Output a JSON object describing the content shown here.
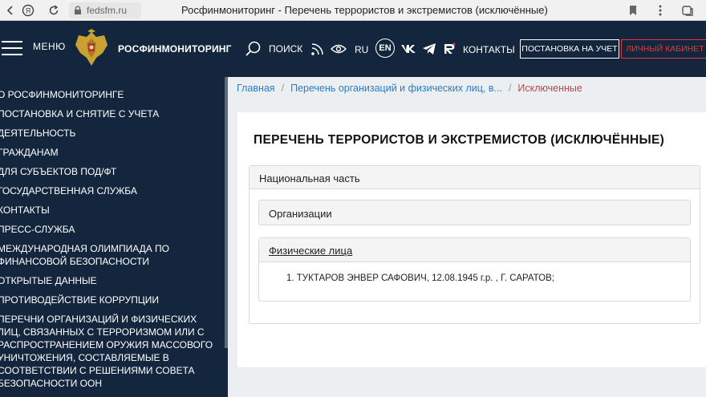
{
  "browser": {
    "url": "fedsfm.ru",
    "tab_title": "Росфинмониторинг - Перечень террористов и экстремистов (исключённые)"
  },
  "header": {
    "menu_label": "МЕНЮ",
    "brand": "РОСФИНМОНИТОРИНГ",
    "search_label": "ПОИСК",
    "lang_ru": "RU",
    "lang_en": "EN",
    "contacts": "КОНТАКТЫ",
    "register_button": "ПОСТАНОВКА НА УЧЕТ",
    "cabinet_button": "ЛИЧНЫЙ КАБИНЕТ",
    "accent_color": "#e03a3a",
    "background_color": "#13263d"
  },
  "sidebar": {
    "items": [
      "О РОСФИНМОНИТОРИНГЕ",
      "ПОСТАНОВКА И СНЯТИЕ С УЧЕТА",
      "ДЕЯТЕЛЬНОСТЬ",
      "ГРАЖДАНАМ",
      "ДЛЯ СУБЪЕКТОВ ПОД/ФТ",
      "ГОСУДАРСТВЕННАЯ СЛУЖБА",
      "КОНТАКТЫ",
      "ПРЕСС-СЛУЖБА",
      "МЕЖДУНАРОДНАЯ ОЛИМПИАДА ПО ФИНАНСОВОЙ БЕЗОПАСНОСТИ",
      "ОТКРЫТЫЕ ДАННЫЕ",
      "ПРОТИВОДЕЙСТВИЕ КОРРУПЦИИ",
      "ПЕРЕЧНИ ОРГАНИЗАЦИЙ И ФИЗИЧЕСКИХ ЛИЦ, СВЯЗАННЫХ С ТЕРРОРИЗМОМ ИЛИ С РАСПРОСТРАНЕНИЕМ ОРУЖИЯ МАССОВОГО УНИЧТОЖЕНИЯ, СОСТАВЛЯЕМЫЕ В СООТВЕТСТВИИ С РЕШЕНИЯМИ СОВЕТА БЕЗОПАСНОСТИ ООН"
    ]
  },
  "breadcrumb": {
    "home": "Главная",
    "parent": "Перечень организаций и физических лиц, в...",
    "current": "Исключенные"
  },
  "main": {
    "heading": "ПЕРЕЧЕНЬ ТЕРРОРИСТОВ И ЭКСТРЕМИСТОВ (ИСКЛЮЧЁННЫЕ)",
    "national_part": "Национальная часть",
    "organizations": "Организации",
    "individuals": "Физические лица",
    "entries": [
      "1. ТУКТАРОВ ЭНВЕР САФОВИЧ, 12.08.1945 г.р. , Г. САРАТОВ;"
    ]
  }
}
